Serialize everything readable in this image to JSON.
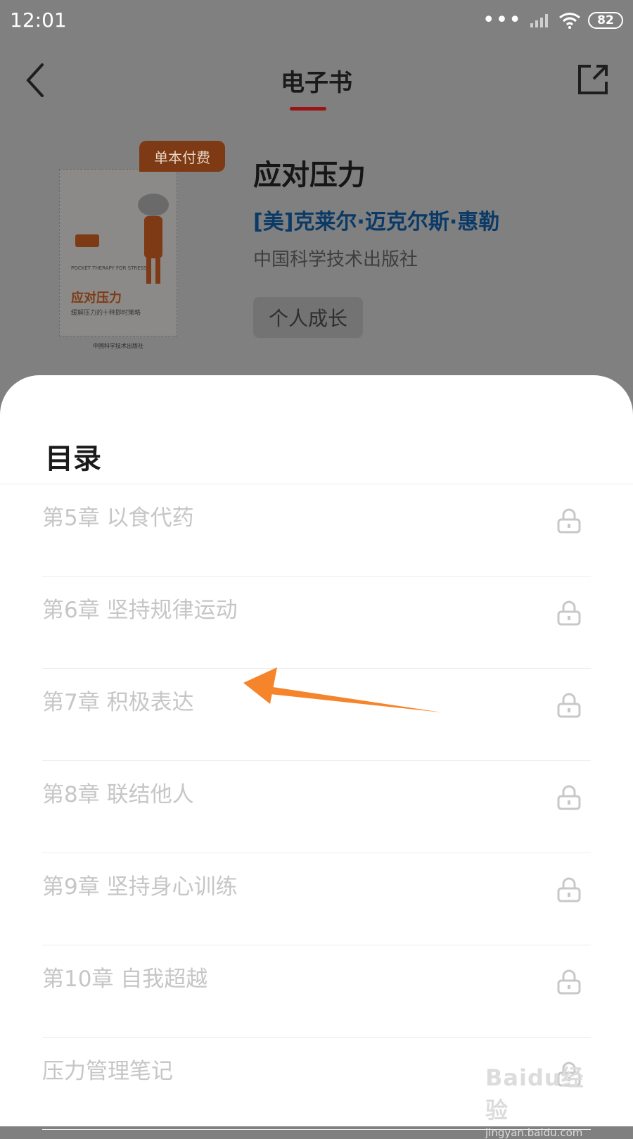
{
  "status_bar": {
    "time": "12:01",
    "battery": "82"
  },
  "header": {
    "title": "电子书"
  },
  "book": {
    "tag": "单本付费",
    "title": "应对压力",
    "author": "[美]克莱尔·迈克尔斯·惠勒",
    "publisher": "中国科学技术出版社",
    "category": "个人成长",
    "cover": {
      "title": "应对压力",
      "subtitle": "缓解压力的十种即时策略",
      "english": "POCKET THERAPY FOR STRESS",
      "publisher": "中国科学技术出版社"
    }
  },
  "toc": {
    "title": "目录",
    "items": [
      {
        "label": "第5章 以食代药"
      },
      {
        "label": "第6章 坚持规律运动"
      },
      {
        "label": "第7章 积极表达"
      },
      {
        "label": "第8章 联结他人"
      },
      {
        "label": "第9章 坚持身心训练"
      },
      {
        "label": "第10章 自我超越"
      },
      {
        "label": "压力管理笔记"
      }
    ]
  },
  "watermark": {
    "main": "Baidu经验",
    "sub": "jingyan.baidu.com"
  },
  "colors": {
    "accent": "#d02424",
    "annotation_arrow": "#f5842a",
    "author_link": "#1a73c8"
  }
}
